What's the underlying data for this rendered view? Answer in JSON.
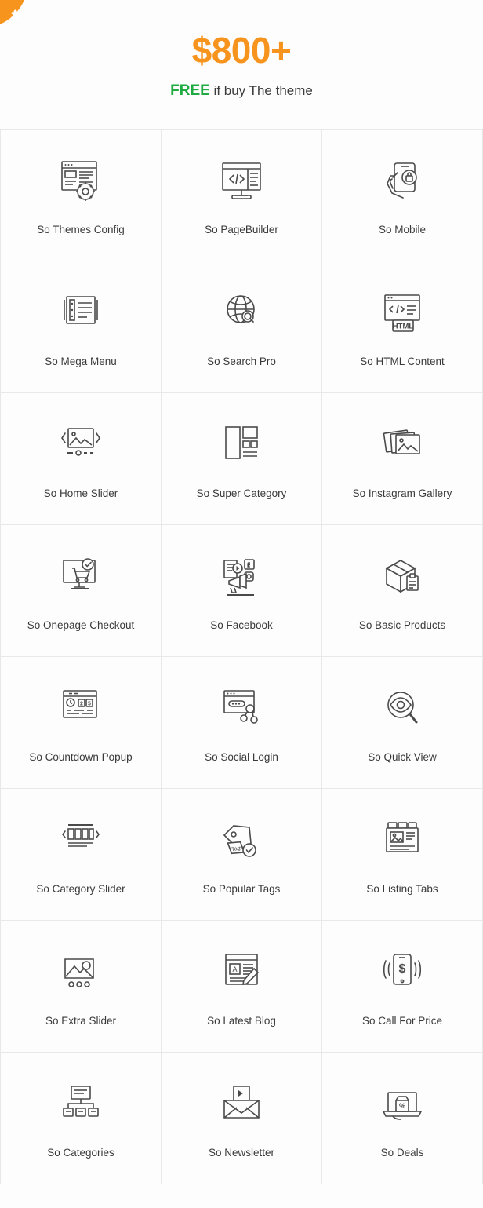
{
  "badge": {
    "icon": "puzzle-piece-icon",
    "color": "#f7941e"
  },
  "hero": {
    "price": "$800+",
    "free_word": "FREE",
    "sub_rest": " if buy The theme",
    "price_color": "#f7941e",
    "free_color": "#1faa42"
  },
  "grid": {
    "columns": 3,
    "items": [
      {
        "label": "So Themes Config",
        "icon": "themes-config-icon"
      },
      {
        "label": "So PageBuilder",
        "icon": "pagebuilder-icon"
      },
      {
        "label": "So Mobile",
        "icon": "mobile-hand-icon"
      },
      {
        "label": "So Mega Menu",
        "icon": "mega-menu-icon"
      },
      {
        "label": "So Search Pro",
        "icon": "globe-search-icon"
      },
      {
        "label": "So HTML Content",
        "icon": "html-content-icon"
      },
      {
        "label": "So Home Slider",
        "icon": "home-slider-icon"
      },
      {
        "label": "So Super Category",
        "icon": "super-category-icon"
      },
      {
        "label": "So Instagram Gallery",
        "icon": "instagram-gallery-icon"
      },
      {
        "label": "So Onepage Checkout",
        "icon": "onepage-checkout-icon"
      },
      {
        "label": "So Facebook",
        "icon": "facebook-megaphone-icon"
      },
      {
        "label": "So Basic Products",
        "icon": "basic-products-icon"
      },
      {
        "label": "So Countdown Popup",
        "icon": "countdown-popup-icon"
      },
      {
        "label": "So Social Login",
        "icon": "social-login-icon"
      },
      {
        "label": "So Quick View",
        "icon": "quick-view-icon"
      },
      {
        "label": "So Category Slider",
        "icon": "category-slider-icon"
      },
      {
        "label": "So Popular Tags",
        "icon": "popular-tags-icon"
      },
      {
        "label": "So Listing Tabs",
        "icon": "listing-tabs-icon"
      },
      {
        "label": "So Extra Slider",
        "icon": "extra-slider-icon"
      },
      {
        "label": "So Latest Blog",
        "icon": "latest-blog-icon"
      },
      {
        "label": "So Call For Price",
        "icon": "call-for-price-icon"
      },
      {
        "label": "So Categories",
        "icon": "categories-tree-icon"
      },
      {
        "label": "So Newsletter",
        "icon": "newsletter-envelope-icon"
      },
      {
        "label": "So Deals",
        "icon": "deals-laptop-icon"
      }
    ]
  }
}
